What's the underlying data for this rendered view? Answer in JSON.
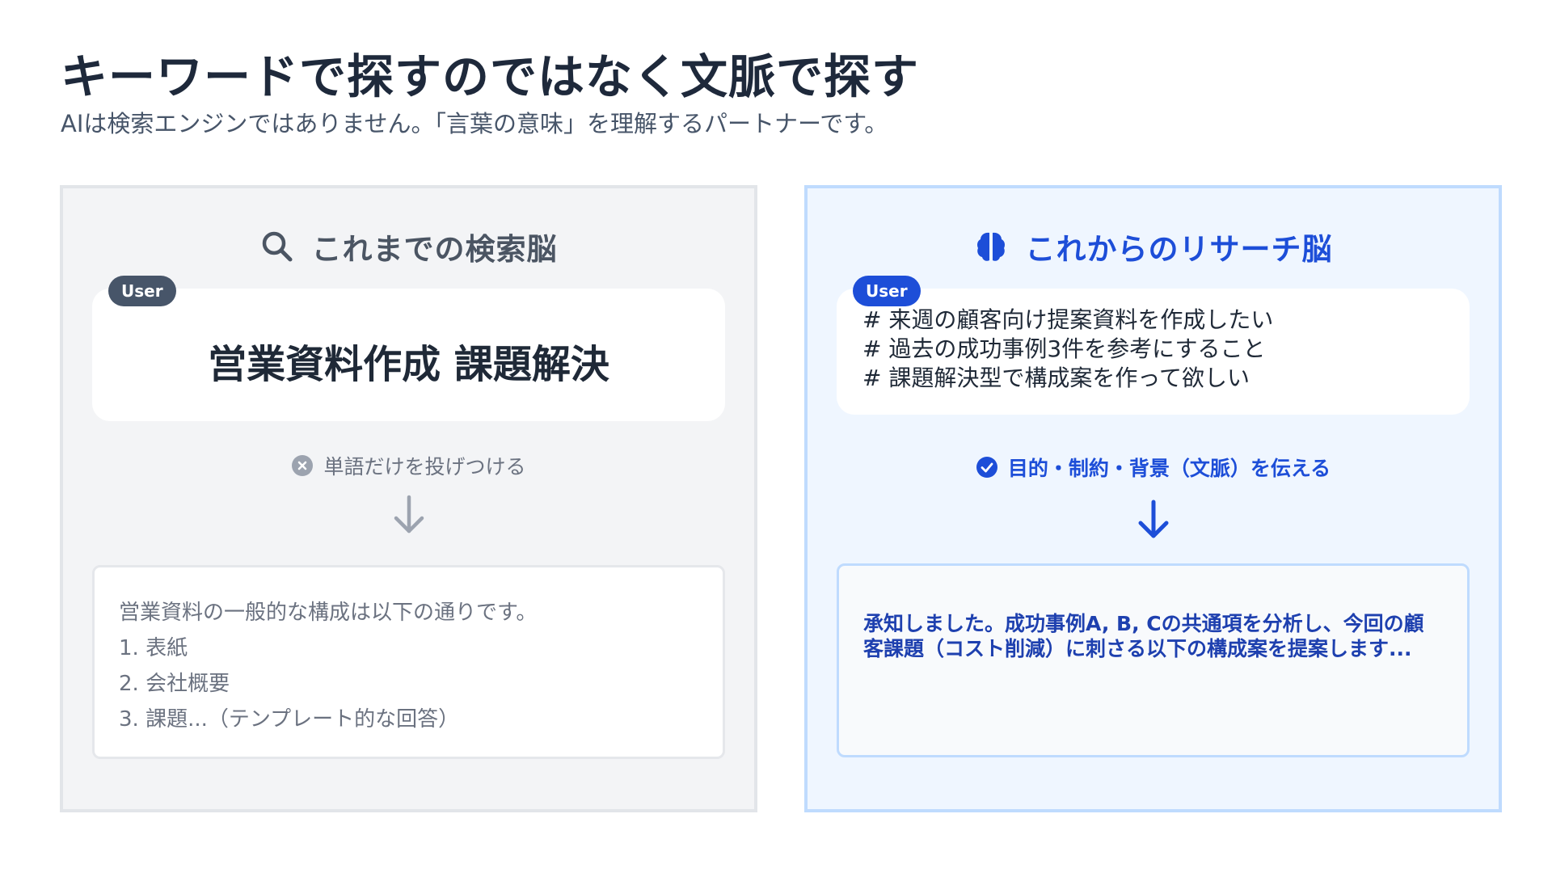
{
  "header": {
    "title": "キーワードで探すのではなく文脈で探す",
    "subtitle": "AIは検索エンジンではありません。「言葉の意味」を理解するパートナーです。"
  },
  "left_panel": {
    "heading": "これまでの検索脳",
    "heading_icon": "search-icon",
    "user_badge": "User",
    "query": "営業資料作成  課題解決",
    "note": "単語だけを投げつける",
    "note_icon": "x-circle-icon",
    "answer_lines": [
      "営業資料の一般的な構成は以下の通りです。",
      "1. 表紙",
      "2. 会社概要",
      "3. 課題...（テンプレート的な回答）"
    ]
  },
  "right_panel": {
    "heading": "これからのリサーチ脳",
    "heading_icon": "brain-icon",
    "user_badge": "User",
    "query_lines": [
      "# 来週の顧客向け提案資料を作成したい",
      "# 過去の成功事例3件を参考にすること",
      "# 課題解決型で構成案を作って欲しい"
    ],
    "note": "目的・制約・背景（文脈）を伝える",
    "note_icon": "check-circle-icon",
    "answer": "承知しました。成功事例A, B, Cの共通項を分析し、今回の顧客課題（コスト削減）に刺さる以下の構成案を提案します..."
  },
  "colors": {
    "accent_blue": "#1d4ed8",
    "gray_text": "#4b5563",
    "left_panel_bg": "#f3f4f6",
    "right_panel_bg": "#eff6ff"
  }
}
